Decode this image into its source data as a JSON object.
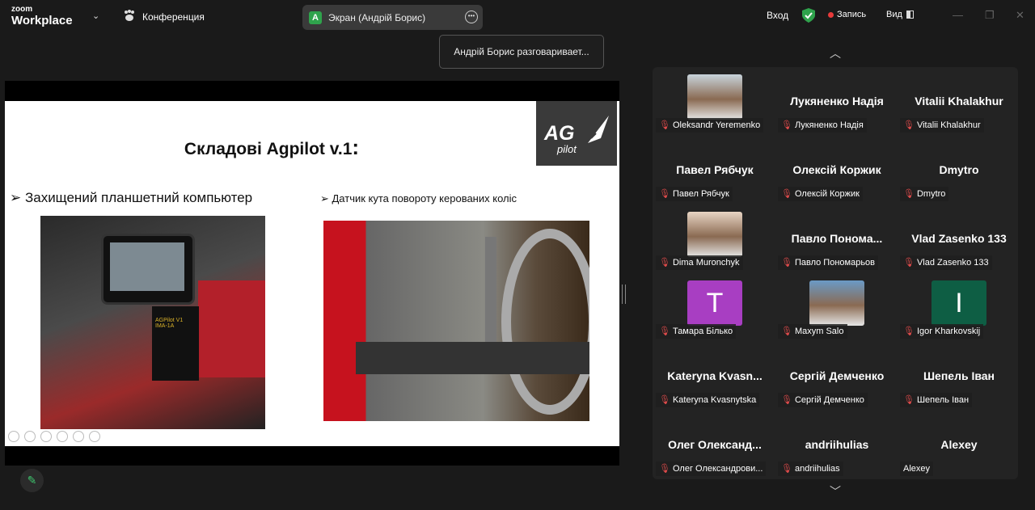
{
  "app": {
    "logo_top": "zoom",
    "logo_bottom": "Workplace",
    "conference_label": "Конференция"
  },
  "screen_tab": {
    "avatar_letter": "A",
    "label": "Экран (Андрій Борис)"
  },
  "header": {
    "signin": "Вход",
    "record": "Запись",
    "view": "Вид"
  },
  "tooltip": "Андрій Борис разговаривает...",
  "slide": {
    "title": "Складові Agpilot v.1",
    "title_colon": ":",
    "logo_ag": "AG",
    "logo_pilot": "pilot",
    "bullet1": "➢ Захищений планшетний компьютер",
    "bullet2": "➢ Датчик кута повороту керованих коліс",
    "device_text": "AGPilot V1 IMA-1A"
  },
  "participants": [
    {
      "name": "Oleksandr Yeremenko",
      "display": "",
      "type": "photo",
      "color": "#c8d4dc"
    },
    {
      "name": "Лукяненко Надія",
      "display": "Лукяненко Надія",
      "type": "name"
    },
    {
      "name": "Vitalii Khalakhur",
      "display": "Vitalii Khalakhur",
      "type": "name"
    },
    {
      "name": "Павел Рябчук",
      "display": "Павел Рябчук",
      "type": "name"
    },
    {
      "name": "Олексій Коржик",
      "display": "Олексій Коржик",
      "type": "name"
    },
    {
      "name": "Dmytro",
      "display": "Dmytro",
      "type": "name"
    },
    {
      "name": "Dima Muronchyk",
      "display": "",
      "type": "photo",
      "color": "#e8d5c4"
    },
    {
      "name": "Павло Пономарьов",
      "display": "Павло Пономa...",
      "type": "name"
    },
    {
      "name": "Vlad Zasenko 133",
      "display": "Vlad Zasenko 133",
      "type": "name"
    },
    {
      "name": "Тамара Білько",
      "display": "T",
      "type": "letter",
      "color": "#a83ec2"
    },
    {
      "name": "Maxym Salo",
      "display": "",
      "type": "photo",
      "color": "#6a9ac6"
    },
    {
      "name": "Igor Kharkovskij",
      "display": "I",
      "type": "letter",
      "color": "#0e5e44"
    },
    {
      "name": "Kateryna Kvasnytska",
      "display": "Kateryna  Kvasn...",
      "type": "name"
    },
    {
      "name": "Сергій Демченко",
      "display": "Сергій Демченко",
      "type": "name"
    },
    {
      "name": "Шепель Іван",
      "display": "Шепель Іван",
      "type": "name"
    },
    {
      "name": "Олег Олександрови...",
      "display": "Олег  Олександ...",
      "type": "name"
    },
    {
      "name": "andriihulias",
      "display": "andriihulias",
      "type": "name"
    },
    {
      "name": "Alexey",
      "display": "Alexey",
      "type": "name",
      "unmuted": true
    }
  ]
}
